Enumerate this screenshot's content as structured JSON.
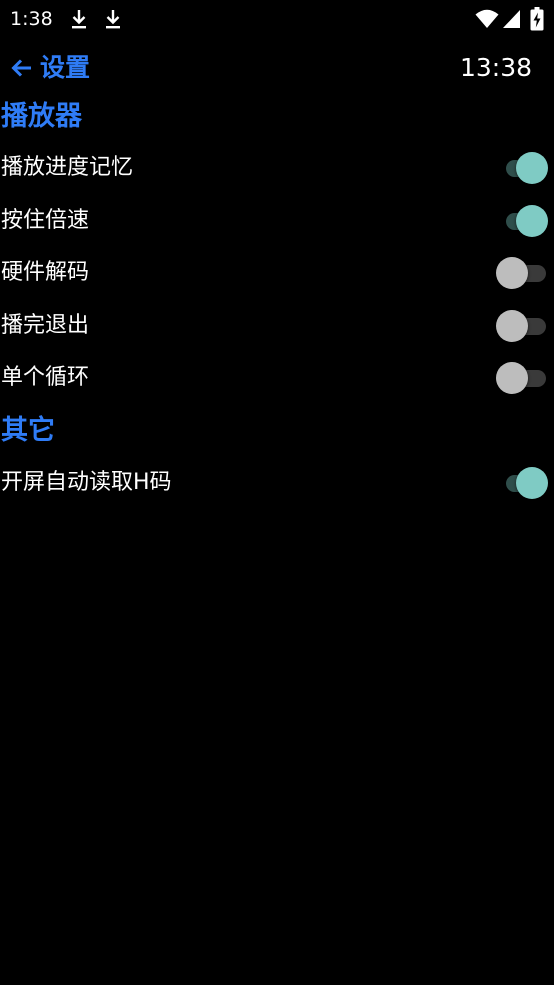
{
  "status_bar": {
    "time": "1:38",
    "icons": [
      "download-icon",
      "download-icon",
      "wifi-icon",
      "signal-icon",
      "battery-charging-icon"
    ]
  },
  "app_bar": {
    "back_icon": "arrow-left-icon",
    "title": "设置",
    "clock": "13:38"
  },
  "colors": {
    "accent": "#2f7cf6",
    "switch_on_thumb": "#7fcbc4",
    "switch_on_track": "#2f4e4b",
    "switch_off_thumb": "#bdbdbd",
    "switch_off_track": "#3a3a3a",
    "background": "#000000"
  },
  "sections": [
    {
      "title": "播放器",
      "items": [
        {
          "label": "播放进度记忆",
          "enabled": true
        },
        {
          "label": "按住倍速",
          "enabled": true
        },
        {
          "label": "硬件解码",
          "enabled": false
        },
        {
          "label": "播完退出",
          "enabled": false
        },
        {
          "label": "单个循环",
          "enabled": false
        }
      ]
    },
    {
      "title": "其它",
      "items": [
        {
          "label": "开屏自动读取H码",
          "enabled": true
        }
      ]
    }
  ]
}
